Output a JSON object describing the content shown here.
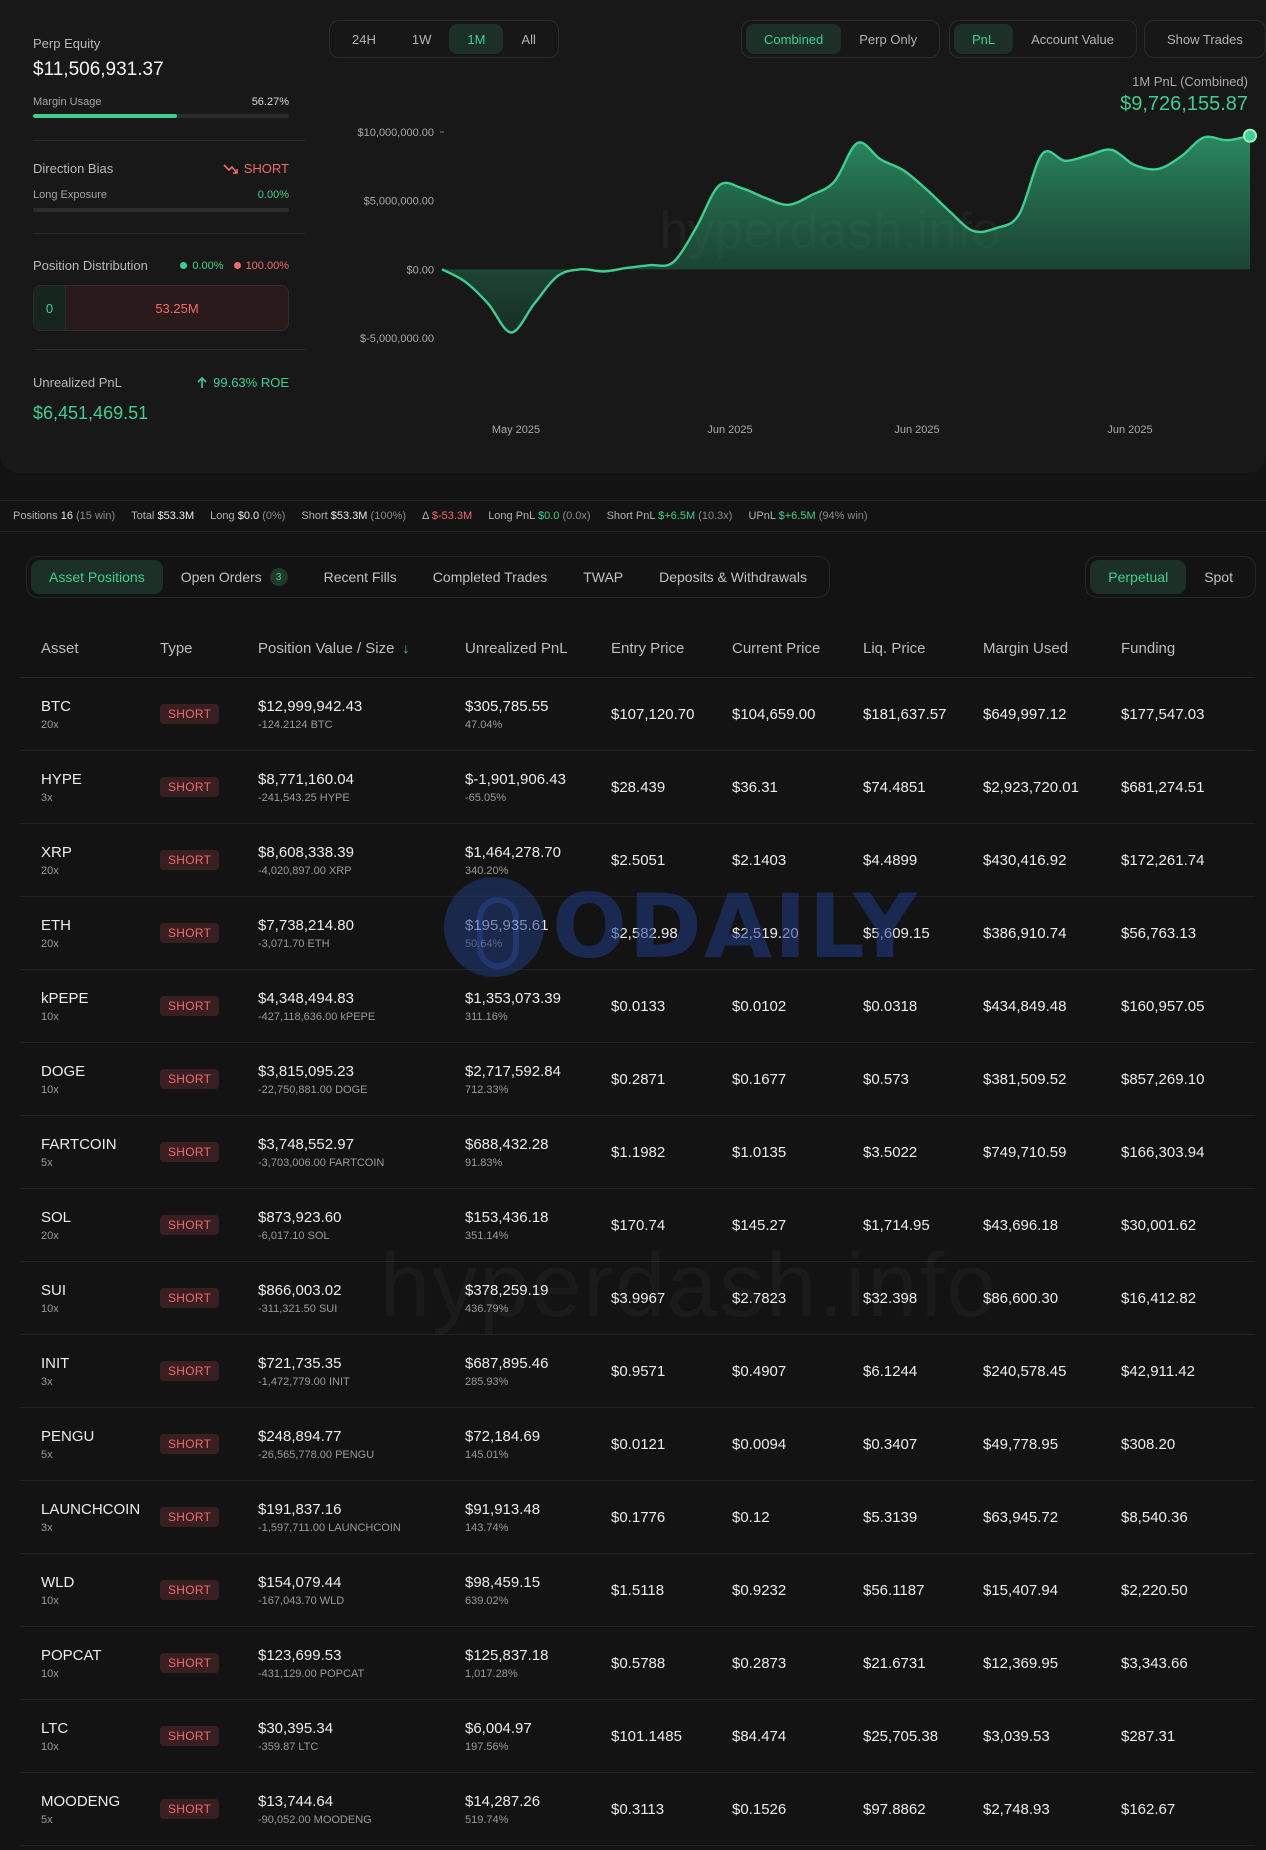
{
  "summary": {
    "perp_equity_label": "Perp Equity",
    "perp_equity_value": "$11,506,931.37",
    "margin_usage_label": "Margin Usage",
    "margin_usage_value": "56.27%",
    "margin_usage_fraction": 0.5627,
    "direction_bias_label": "Direction Bias",
    "direction_bias_value": "SHORT",
    "long_exposure_label": "Long Exposure",
    "long_exposure_value": "0.00%",
    "position_distribution_label": "Position Distribution",
    "pd_long_pct": "0.00%",
    "pd_short_pct": "100.00%",
    "pd_long_value": "0",
    "pd_short_value": "53.25M",
    "unrealized_pnl_label": "Unrealized PnL",
    "roe_value": "99.63% ROE",
    "unrealized_pnl_value": "$6,451,469.51"
  },
  "timeframes": [
    "24H",
    "1W",
    "1M",
    "All"
  ],
  "timeframe_active": "1M",
  "mode_toggle": [
    "Combined",
    "Perp Only"
  ],
  "mode_active": "Combined",
  "metric_toggle": [
    "PnL",
    "Account Value"
  ],
  "metric_active": "PnL",
  "show_trades_label": "Show Trades",
  "chart_header": {
    "title": "1M PnL (Combined)",
    "value": "$9,726,155.87"
  },
  "chart_data": {
    "type": "area",
    "title": "1M PnL (Combined)",
    "xlabel": "",
    "ylabel": "",
    "ylim": [
      -5000000,
      10000000
    ],
    "y_ticks": [
      "$10,000,000.00",
      "$5,000,000.00",
      "$0.00",
      "$-5,000,000.00"
    ],
    "x_tick_labels": [
      "May 2025",
      "Jun 2025",
      "Jun 2025",
      "Jun 2025"
    ],
    "series": [
      {
        "values": [
          0,
          -900000,
          -2500000,
          -4600000,
          -2500000,
          -500000,
          0,
          -150000,
          100000,
          300000,
          500000,
          3000000,
          6100000,
          5900000,
          5200000,
          4700000,
          5400000,
          6400000,
          9200000,
          8000000,
          7200000,
          5800000,
          4200000,
          2800000,
          3000000,
          4000000,
          8400000,
          7900000,
          8300000,
          8700000,
          7600000,
          7300000,
          8200000,
          9600000,
          9400000,
          9726155.87
        ]
      }
    ],
    "grid": false,
    "watermark": "hyperdash.info"
  },
  "stats": {
    "positions_label": "Positions",
    "positions_value": "16",
    "positions_note": "(15 win)",
    "total_label": "Total",
    "total_value": "$53.3M",
    "long_label": "Long",
    "long_value": "$0.0",
    "long_note": "(0%)",
    "short_label": "Short",
    "short_value": "$53.3M",
    "short_note": "(100%)",
    "delta_label": "Δ",
    "delta_value": "$-53.3M",
    "long_pnl_label": "Long PnL",
    "long_pnl_value": "$0.0",
    "long_pnl_note": "(0.0x)",
    "short_pnl_label": "Short PnL",
    "short_pnl_value": "$+6.5M",
    "short_pnl_note": "(10.3x)",
    "upnl_label": "UPnL",
    "upnl_value": "$+6.5M",
    "upnl_note": "(94% win)"
  },
  "tabs": [
    {
      "label": "Asset Positions",
      "active": true
    },
    {
      "label": "Open Orders",
      "badge": "3"
    },
    {
      "label": "Recent Fills"
    },
    {
      "label": "Completed Trades"
    },
    {
      "label": "TWAP"
    },
    {
      "label": "Deposits & Withdrawals"
    }
  ],
  "market_tabs": [
    {
      "label": "Perpetual",
      "active": true
    },
    {
      "label": "Spot"
    }
  ],
  "table": {
    "columns": [
      "Asset",
      "Type",
      "Position Value / Size",
      "Unrealized PnL",
      "Entry Price",
      "Current Price",
      "Liq. Price",
      "Margin Used",
      "Funding"
    ],
    "rows": [
      {
        "asset": "BTC",
        "lev": "20x",
        "type": "SHORT",
        "value": "$12,999,942.43",
        "size": "-124.2124 BTC",
        "upnl": "$305,785.55",
        "upnl_pct": "47.04%",
        "upnl_pos": true,
        "entry": "$107,120.70",
        "current": "$104,659.00",
        "liq": "$181,637.57",
        "margin": "$649,997.12",
        "funding": "$177,547.03"
      },
      {
        "asset": "HYPE",
        "lev": "3x",
        "type": "SHORT",
        "value": "$8,771,160.04",
        "size": "-241,543.25 HYPE",
        "upnl": "$-1,901,906.43",
        "upnl_pct": "-65.05%",
        "upnl_pos": false,
        "entry": "$28.439",
        "current": "$36.31",
        "liq": "$74.4851",
        "margin": "$2,923,720.01",
        "funding": "$681,274.51"
      },
      {
        "asset": "XRP",
        "lev": "20x",
        "type": "SHORT",
        "value": "$8,608,338.39",
        "size": "-4,020,897.00 XRP",
        "upnl": "$1,464,278.70",
        "upnl_pct": "340.20%",
        "upnl_pos": true,
        "entry": "$2.5051",
        "current": "$2.1403",
        "liq": "$4.4899",
        "margin": "$430,416.92",
        "funding": "$172,261.74"
      },
      {
        "asset": "ETH",
        "lev": "20x",
        "type": "SHORT",
        "value": "$7,738,214.80",
        "size": "-3,071.70 ETH",
        "upnl": "$195,935.61",
        "upnl_pct": "50.64%",
        "upnl_pos": true,
        "entry": "$2,582.98",
        "current": "$2,519.20",
        "liq": "$5,609.15",
        "margin": "$386,910.74",
        "funding": "$56,763.13"
      },
      {
        "asset": "kPEPE",
        "lev": "10x",
        "type": "SHORT",
        "value": "$4,348,494.83",
        "size": "-427,118,636.00 kPEPE",
        "upnl": "$1,353,073.39",
        "upnl_pct": "311.16%",
        "upnl_pos": true,
        "entry": "$0.0133",
        "current": "$0.0102",
        "liq": "$0.0318",
        "margin": "$434,849.48",
        "funding": "$160,957.05"
      },
      {
        "asset": "DOGE",
        "lev": "10x",
        "type": "SHORT",
        "value": "$3,815,095.23",
        "size": "-22,750,881.00 DOGE",
        "upnl": "$2,717,592.84",
        "upnl_pct": "712.33%",
        "upnl_pos": true,
        "entry": "$0.2871",
        "current": "$0.1677",
        "liq": "$0.573",
        "margin": "$381,509.52",
        "funding": "$857,269.10"
      },
      {
        "asset": "FARTCOIN",
        "lev": "5x",
        "type": "SHORT",
        "value": "$3,748,552.97",
        "size": "-3,703,006.00 FARTCOIN",
        "upnl": "$688,432.28",
        "upnl_pct": "91.83%",
        "upnl_pos": true,
        "entry": "$1.1982",
        "current": "$1.0135",
        "liq": "$3.5022",
        "margin": "$749,710.59",
        "funding": "$166,303.94"
      },
      {
        "asset": "SOL",
        "lev": "20x",
        "type": "SHORT",
        "value": "$873,923.60",
        "size": "-6,017.10 SOL",
        "upnl": "$153,436.18",
        "upnl_pct": "351.14%",
        "upnl_pos": true,
        "entry": "$170.74",
        "current": "$145.27",
        "liq": "$1,714.95",
        "margin": "$43,696.18",
        "funding": "$30,001.62"
      },
      {
        "asset": "SUI",
        "lev": "10x",
        "type": "SHORT",
        "value": "$866,003.02",
        "size": "-311,321.50 SUI",
        "upnl": "$378,259.19",
        "upnl_pct": "436.79%",
        "upnl_pos": true,
        "entry": "$3.9967",
        "current": "$2.7823",
        "liq": "$32.398",
        "margin": "$86,600.30",
        "funding": "$16,412.82"
      },
      {
        "asset": "INIT",
        "lev": "3x",
        "type": "SHORT",
        "value": "$721,735.35",
        "size": "-1,472,779.00 INIT",
        "upnl": "$687,895.46",
        "upnl_pct": "285.93%",
        "upnl_pos": true,
        "entry": "$0.9571",
        "current": "$0.4907",
        "liq": "$6.1244",
        "margin": "$240,578.45",
        "funding": "$42,911.42"
      },
      {
        "asset": "PENGU",
        "lev": "5x",
        "type": "SHORT",
        "value": "$248,894.77",
        "size": "-26,565,778.00 PENGU",
        "upnl": "$72,184.69",
        "upnl_pct": "145.01%",
        "upnl_pos": true,
        "entry": "$0.0121",
        "current": "$0.0094",
        "liq": "$0.3407",
        "margin": "$49,778.95",
        "funding": "$308.20"
      },
      {
        "asset": "LAUNCHCOIN",
        "lev": "3x",
        "type": "SHORT",
        "value": "$191,837.16",
        "size": "-1,597,711.00 LAUNCHCOIN",
        "upnl": "$91,913.48",
        "upnl_pct": "143.74%",
        "upnl_pos": true,
        "entry": "$0.1776",
        "current": "$0.12",
        "liq": "$5.3139",
        "margin": "$63,945.72",
        "funding": "$8,540.36"
      },
      {
        "asset": "WLD",
        "lev": "10x",
        "type": "SHORT",
        "value": "$154,079.44",
        "size": "-167,043.70 WLD",
        "upnl": "$98,459.15",
        "upnl_pct": "639.02%",
        "upnl_pos": true,
        "entry": "$1.5118",
        "current": "$0.9232",
        "liq": "$56.1187",
        "margin": "$15,407.94",
        "funding": "$2,220.50"
      },
      {
        "asset": "POPCAT",
        "lev": "10x",
        "type": "SHORT",
        "value": "$123,699.53",
        "size": "-431,129.00 POPCAT",
        "upnl": "$125,837.18",
        "upnl_pct": "1,017.28%",
        "upnl_pos": true,
        "entry": "$0.5788",
        "current": "$0.2873",
        "liq": "$21.6731",
        "margin": "$12,369.95",
        "funding": "$3,343.66"
      },
      {
        "asset": "LTC",
        "lev": "10x",
        "type": "SHORT",
        "value": "$30,395.34",
        "size": "-359.87 LTC",
        "upnl": "$6,004.97",
        "upnl_pct": "197.56%",
        "upnl_pos": true,
        "entry": "$101.1485",
        "current": "$84.474",
        "liq": "$25,705.38",
        "margin": "$3,039.53",
        "funding": "$287.31"
      },
      {
        "asset": "MOODENG",
        "lev": "5x",
        "type": "SHORT",
        "value": "$13,744.64",
        "size": "-90,052.00 MOODENG",
        "upnl": "$14,287.26",
        "upnl_pct": "519.74%",
        "upnl_pos": true,
        "entry": "$0.3113",
        "current": "$0.1526",
        "liq": "$97.8862",
        "margin": "$2,748.93",
        "funding": "$162.67"
      }
    ]
  },
  "watermarks": {
    "site": "hyperdash.info",
    "odaily": "ODAILY"
  },
  "colors": {
    "background": "#131313",
    "panel": "#181818",
    "accent_green": "#3ccf91",
    "accent_red": "#ef6a6a",
    "short_badge_bg": "#3a1f22"
  },
  "icons": {
    "direction": "trend-down-icon",
    "roe": "arrow-up-icon",
    "sort": "arrow-down-icon"
  }
}
